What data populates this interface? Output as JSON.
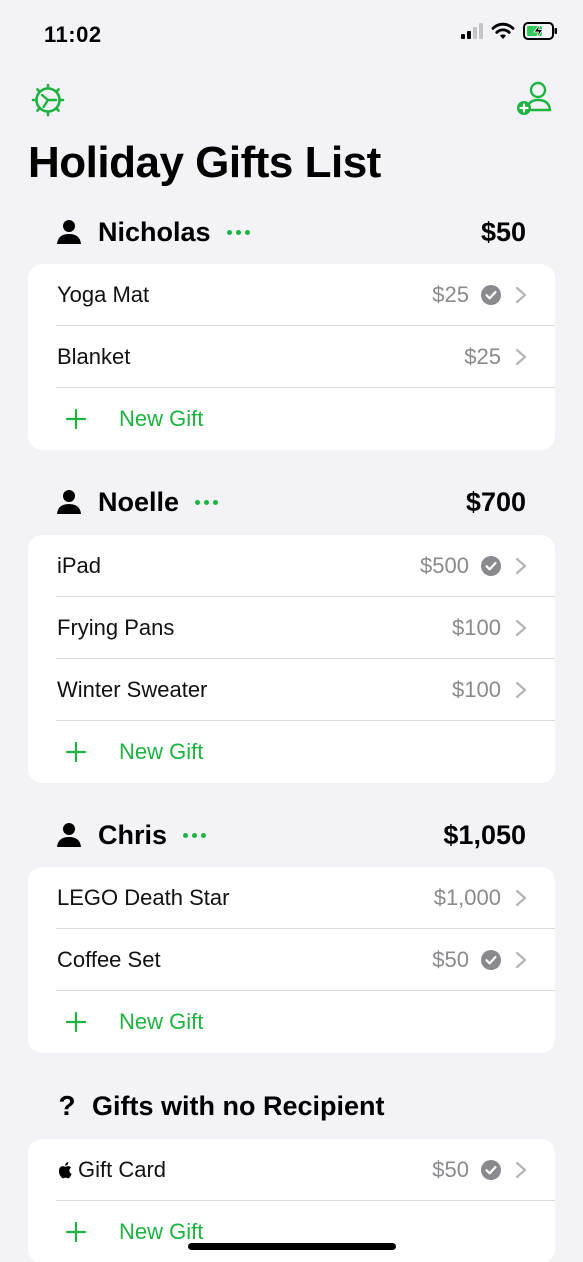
{
  "status_bar": {
    "time": "11:02"
  },
  "page": {
    "title": "Holiday Gifts List"
  },
  "sections": [
    {
      "name": "Nicholas",
      "total": "$50",
      "gifts": [
        {
          "name": "Yoga Mat",
          "price": "$25",
          "purchased": true
        },
        {
          "name": "Blanket",
          "price": "$25",
          "purchased": false
        }
      ],
      "new_gift_label": "New Gift"
    },
    {
      "name": "Noelle",
      "total": "$700",
      "gifts": [
        {
          "name": "iPad",
          "price": "$500",
          "purchased": true
        },
        {
          "name": "Frying Pans",
          "price": "$100",
          "purchased": false
        },
        {
          "name": "Winter Sweater",
          "price": "$100",
          "purchased": false
        }
      ],
      "new_gift_label": "New Gift"
    },
    {
      "name": "Chris",
      "total": "$1,050",
      "gifts": [
        {
          "name": "LEGO Death Star",
          "price": "$1,000",
          "purchased": false
        },
        {
          "name": "Coffee Set",
          "price": "$50",
          "purchased": true
        }
      ],
      "new_gift_label": "New Gift"
    }
  ],
  "no_recipient": {
    "icon": "?",
    "title": "Gifts with no Recipient",
    "gifts": [
      {
        "name": "Gift Card",
        "price": "$50",
        "purchased": true,
        "brand_icon": "apple-logo-icon"
      }
    ],
    "new_gift_label": "New Gift"
  },
  "colors": {
    "accent": "#1cb43f",
    "background": "#f2f2f7",
    "secondary_text": "#8a8a8e",
    "check_fill": "#8a8a8e"
  }
}
